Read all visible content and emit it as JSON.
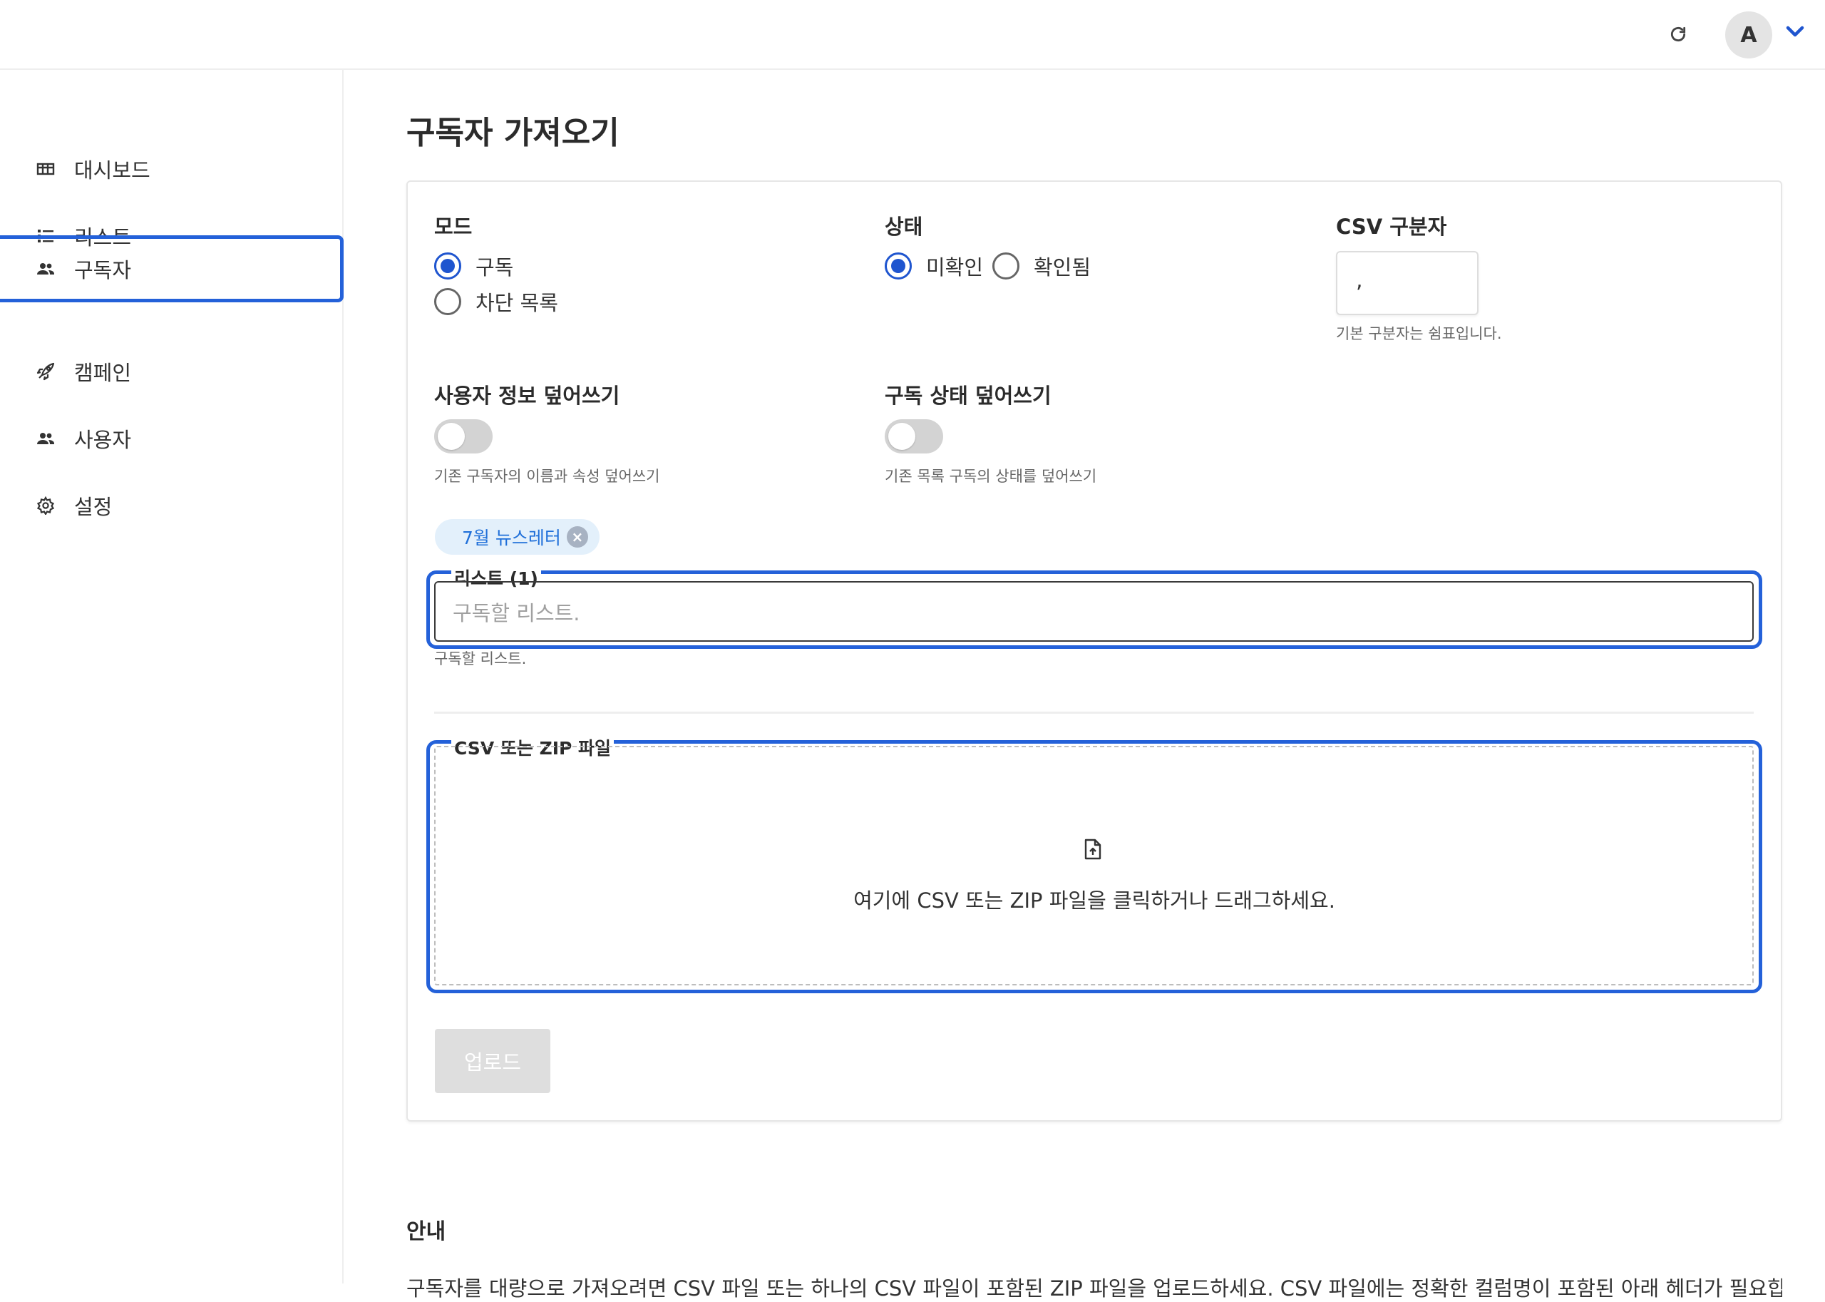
{
  "header": {
    "refresh_icon": "refresh-icon",
    "avatar_initial": "A",
    "caret_icon": "chevron-down-icon",
    "accent_color": "#1f55cf"
  },
  "sidebar": {
    "items": [
      {
        "label": "대시보드",
        "icon": "dashboard-icon"
      },
      {
        "label": "리스트",
        "icon": "list-icon"
      },
      {
        "label": "구독자",
        "icon": "users-icon",
        "active": true
      },
      {
        "label": "캠페인",
        "icon": "rocket-icon"
      },
      {
        "label": "사용자",
        "icon": "users-icon"
      },
      {
        "label": "설정",
        "icon": "gear-icon"
      }
    ]
  },
  "main": {
    "title": "구독자 가져오기",
    "mode": {
      "label": "모드",
      "options": [
        "구독",
        "차단 목록"
      ],
      "selected": "구독"
    },
    "status": {
      "label": "상태",
      "options": [
        "미확인",
        "확인됨"
      ],
      "selected": "미확인"
    },
    "delimiter": {
      "label": "CSV 구분자",
      "value": ",",
      "help": "기본 구분자는 쉼표입니다."
    },
    "overwrite_user": {
      "label": "사용자 정보 덮어쓰기",
      "enabled": false,
      "help": "기존 구독자의 이름과 속성 덮어쓰기"
    },
    "overwrite_status": {
      "label": "구독 상태 덮어쓰기",
      "enabled": false,
      "help": "기존 목록 구독의 상태를 덮어쓰기"
    },
    "lists": {
      "tag": "7월 뉴스레터",
      "legend": "리스트 (1)",
      "placeholder": "구독할 리스트.",
      "help": "구독할 리스트."
    },
    "file": {
      "legend": "CSV 또는 ZIP 파일",
      "drop_text": "여기에 CSV 또는 ZIP 파일을 클릭하거나 드래그하세요."
    },
    "upload_label": "업로드",
    "info": {
      "title": "안내",
      "text": "구독자를 대량으로 가져오려면 CSV 파일 또는 하나의 CSV 파일이 포함된 ZIP 파일을 업로드하세요. CSV 파일에는 정확한 컬럼명이 포함된 아래 헤더가 필요합니다."
    }
  }
}
